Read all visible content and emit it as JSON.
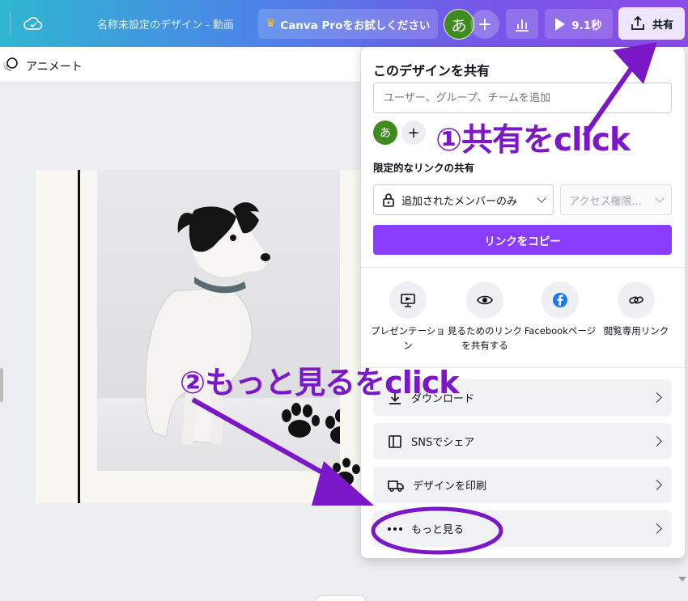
{
  "topbar": {
    "doc_title": "名称未設定のデザイン - 動画",
    "pro_button": "Canva Proをお試しください",
    "avatar_initial": "あ",
    "plus": "+",
    "duration": "9.1秒",
    "share_label": "共有",
    "icons": [
      "cloud-check-icon",
      "crown-icon",
      "bar-chart-icon",
      "play-icon",
      "share-upload-icon"
    ]
  },
  "subbar": {
    "animate_label": "アニメート"
  },
  "share_panel": {
    "title": "このデザインを共有",
    "user_input_placeholder": "ユーザー、グループ、チームを追加",
    "member_initial": "あ",
    "add_member": "+",
    "link_heading": "限定的なリンクの共有",
    "access_value": "追加されたメンバーのみ",
    "permission_value": "アクセス権限...",
    "copy_link": "リンクをコピー",
    "options": [
      {
        "label": "プレゼンテーション",
        "icon": "presentation-icon"
      },
      {
        "label": "見るためのリンクを共有する",
        "icon": "eye-icon"
      },
      {
        "label": "Facebookページ",
        "icon": "facebook-icon"
      },
      {
        "label": "閲覧専用リンク",
        "icon": "link-icon"
      }
    ],
    "rows": [
      {
        "label": "ダウンロード",
        "icon": "download-icon"
      },
      {
        "label": "SNSでシェア",
        "icon": "layout-icon"
      },
      {
        "label": "デザインを印刷",
        "icon": "truck-icon"
      },
      {
        "label": "もっと見る",
        "icon": "more-dots-icon"
      }
    ]
  },
  "annotations": {
    "step1": "①共有をclick",
    "step2": "②もっと見るをclick",
    "color": "#7a17c9"
  },
  "colors": {
    "accent": "#8b3dff",
    "avatar": "#3f8b1f"
  }
}
